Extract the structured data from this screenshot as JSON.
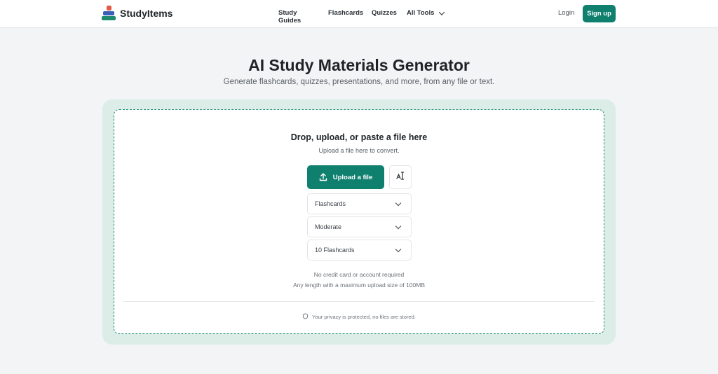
{
  "brand": {
    "name": "StudyItems",
    "colors": {
      "red": "#e15a4a",
      "blue": "#3a5fb8",
      "green": "#1f8a6e"
    }
  },
  "nav": {
    "links": [
      "Study Guides",
      "Flashcards",
      "Quizzes",
      "All Tools"
    ],
    "login": "Login",
    "signup": "Sign up"
  },
  "hero": {
    "title": "AI Study Materials Generator",
    "subtitle": "Generate flashcards, quizzes, presentations, and more, from any file or text."
  },
  "dropzone": {
    "title": "Drop, upload, or paste a file here",
    "subtitle": "Upload a file here to convert.",
    "upload_button": "Upload a file",
    "side_icon": "text-input-icon",
    "selects": {
      "type": "Flashcards",
      "difficulty": "Moderate",
      "count": "10 Flashcards"
    },
    "note1": "No credit card or account required",
    "note2": "Any length with a maximum upload size of 100MB",
    "privacy": "Your privacy is protected, no files are stored."
  },
  "accent_color": "#0f7f6e"
}
